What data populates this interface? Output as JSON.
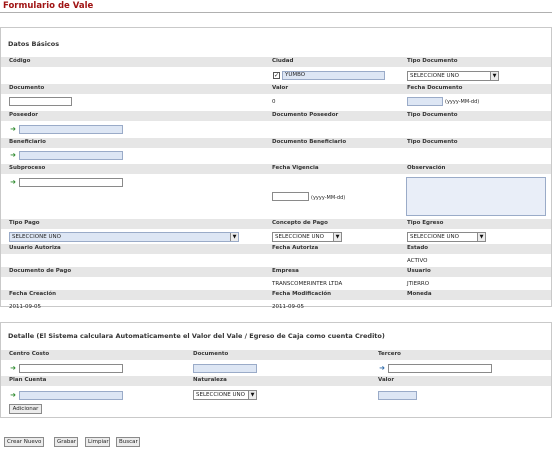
{
  "page": {
    "title": "Formulario de Vale"
  },
  "section1": {
    "title": "Datos Básicos",
    "labels": {
      "codigo": "Código",
      "ciudad": "Ciudad",
      "tipo_documento": "Tipo Documento",
      "documento": "Documento",
      "valor": "Valor",
      "fecha_documento": "Fecha Documento",
      "poseedor": "Poseedor",
      "documento_poseedor": "Documento Poseedor",
      "tipo_documento_2": "Tipo Documento",
      "beneficiario": "Beneficiario",
      "documento_beneficiario": "Documento Beneficiario",
      "tipo_documento_3": "Tipo Documento",
      "subproceso": "Subproceso",
      "fecha_vigencia": "Fecha Vigencia",
      "observacion": "Observación",
      "tipo_pago": "Tipo Pago",
      "concepto_pago": "Concepto de Pago",
      "tipo_egreso": "Tipo Egreso",
      "usuario_autoriza": "Usuario Autoriza",
      "fecha_autoriza": "Fecha Autoriza",
      "estado": "Estado",
      "documento_pago": "Documento de Pago",
      "empresa": "Empresa",
      "usuario": "Usuario",
      "fecha_creacion": "Fecha Creación",
      "fecha_modificacion": "Fecha Modificación",
      "moneda": "Moneda"
    },
    "values": {
      "ciudad": "YUMBO",
      "tipo_documento": "SELECCIONE UNO",
      "valor": "0",
      "fecha_documento_hint": "(yyyy-MM-dd)",
      "fecha_vigencia_hint": "(yyyy-MM-dd)",
      "tipo_pago": "SELECCIONE UNO",
      "concepto_pago": "SELECCIONE UNO",
      "tipo_egreso": "SELECCIONE UNO",
      "estado": "ACTIVO",
      "empresa": "TRANSCOMERINTER LTDA",
      "usuario": "JTIERRO",
      "fecha_creacion": "2011-09-05",
      "fecha_modificacion": "2011-09-05"
    }
  },
  "section2": {
    "title": "Detalle (El Sistema calculara Automaticamente el Valor del Vale / Egreso de Caja como cuenta Credito)",
    "labels": {
      "centro_costo": "Centro Costo",
      "documento": "Documento",
      "tercero": "Tercero",
      "plan_cuenta": "Plan Cuenta",
      "naturaleza": "Naturaleza",
      "valor": "Valor"
    },
    "values": {
      "naturaleza": "SELECCIONE UNO"
    },
    "add_button": "Adicionar"
  },
  "footer": {
    "crear_nuevo": "Crear Nuevo",
    "grabar": "Grabar",
    "limpiar": "Limpiar",
    "buscar": "Buscar"
  },
  "icons": {
    "lookup": "green-arrow-icon",
    "check": "checkmark-icon",
    "dropdown": "chevron-down-icon"
  }
}
